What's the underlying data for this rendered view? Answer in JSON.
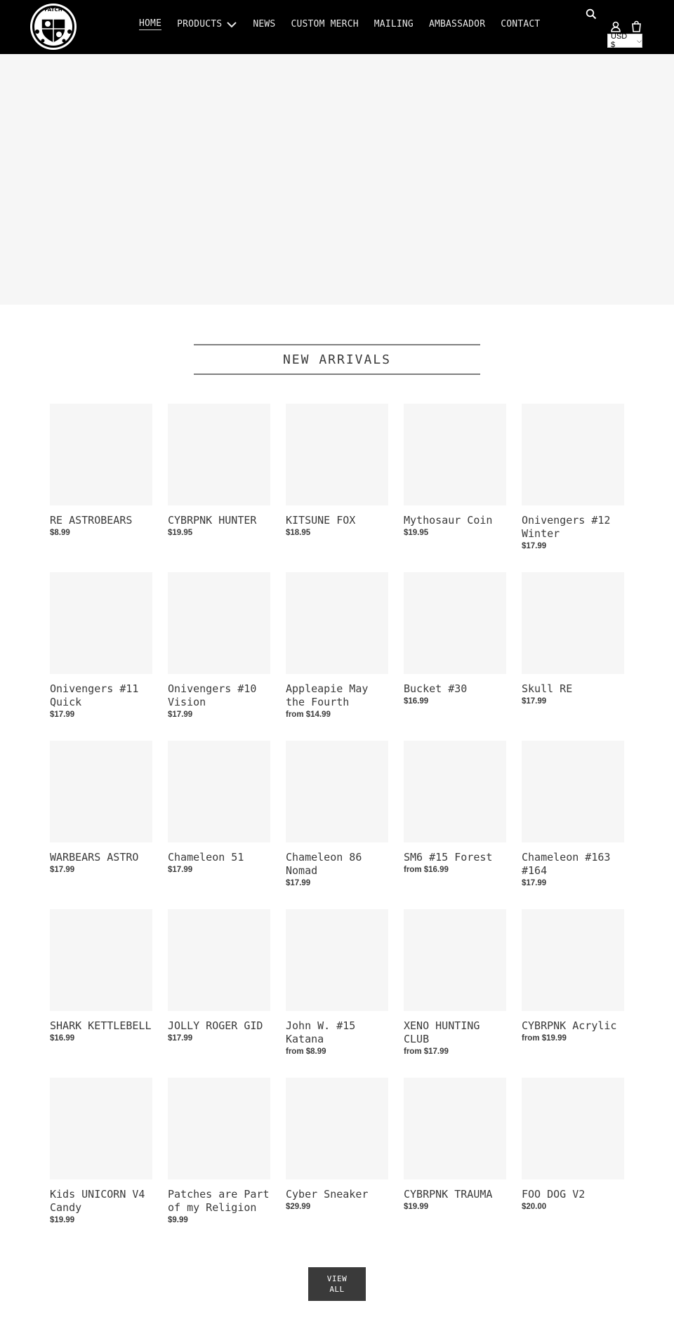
{
  "header": {
    "logo_alt": "Patch Supply logo",
    "nav": [
      {
        "label": "HOME",
        "active": true
      },
      {
        "label": "PRODUCTS",
        "has_dropdown": true
      },
      {
        "label": "NEWS"
      },
      {
        "label": "CUSTOM MERCH"
      },
      {
        "label": "MAILING"
      },
      {
        "label": "AMBASSADOR"
      },
      {
        "label": "CONTACT"
      }
    ],
    "icons": [
      "search-icon",
      "account-icon",
      "cart-icon"
    ],
    "currency": "USD $"
  },
  "section": {
    "title": "NEW ARRIVALS"
  },
  "products": [
    [
      {
        "title": "RE ASTROBEARS",
        "price": "$8.99"
      },
      {
        "title": "CYBRPNK HUNTER",
        "price": "$19.95"
      },
      {
        "title": "KITSUNE FOX",
        "price": "$18.95"
      },
      {
        "title": "Mythosaur Coin",
        "price": "$19.95"
      },
      {
        "title": "Onivengers #12 Winter",
        "price": "$17.99"
      }
    ],
    [
      {
        "title": "Onivengers #11 Quick",
        "price": "$17.99"
      },
      {
        "title": "Onivengers #10 Vision",
        "price": "$17.99"
      },
      {
        "title": "Appleapie May the Fourth",
        "price": "from $14.99"
      },
      {
        "title": "Bucket #30",
        "price": "$16.99"
      },
      {
        "title": "Skull RE",
        "price": "$17.99"
      }
    ],
    [
      {
        "title": "WARBEARS ASTRO",
        "price": "$17.99"
      },
      {
        "title": "Chameleon 51",
        "price": "$17.99"
      },
      {
        "title": "Chameleon 86 Nomad",
        "price": "$17.99"
      },
      {
        "title": "SM6 #15 Forest",
        "price": "from $16.99"
      },
      {
        "title": "Chameleon #163 #164",
        "price": "$17.99"
      }
    ],
    [
      {
        "title": "SHARK KETTLEBELL",
        "price": "$16.99"
      },
      {
        "title": "JOLLY ROGER GID",
        "price": "$17.99"
      },
      {
        "title": "John W. #15 Katana",
        "price": "from $8.99"
      },
      {
        "title": "XENO HUNTING CLUB",
        "price": "from $17.99"
      },
      {
        "title": "CYBRPNK Acrylic",
        "price": "from $19.99"
      }
    ],
    [
      {
        "title": "Kids UNICORN V4 Candy",
        "price": "$19.99"
      },
      {
        "title": "Patches are Part of my Religion",
        "price": "$9.99"
      },
      {
        "title": "Cyber Sneaker",
        "price": "$29.99"
      },
      {
        "title": "CYBRPNK TRAUMA",
        "price": "$19.99"
      },
      {
        "title": "FOO DOG V2",
        "price": "$20.00"
      }
    ]
  ],
  "view_all": {
    "label": "VIEW ALL"
  },
  "colors": {
    "header_bg": "#000000",
    "placeholder_bg": "#f6f6f6",
    "text": "#3a3a3a",
    "button_bg": "#3a3a3a"
  }
}
